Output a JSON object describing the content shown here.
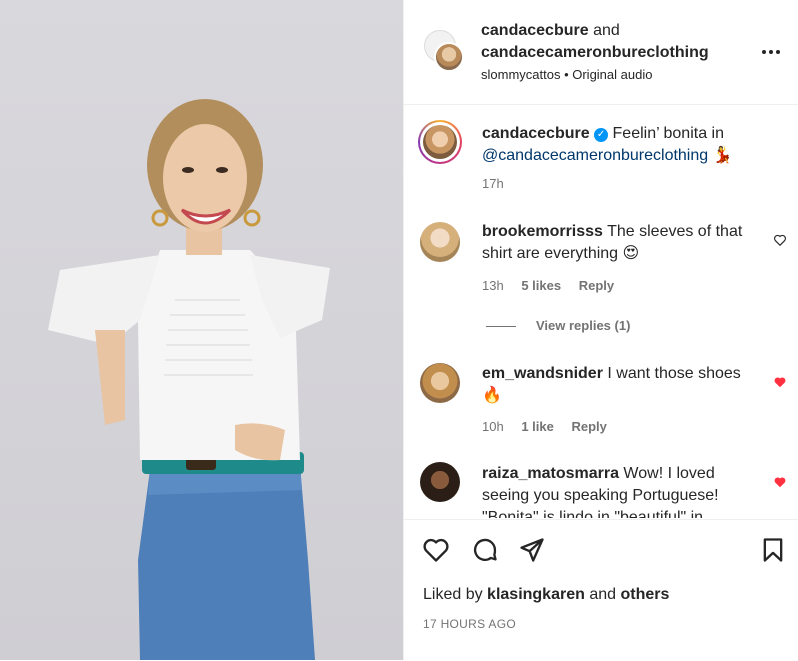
{
  "media": {
    "alt": "",
    "colors": {
      "backdrop": "#d6d5da",
      "shirt": "#f7f7f7",
      "skirt": "#4f7fb8",
      "belt": "#1f8a8a"
    }
  },
  "header": {
    "user1": "candacecbure",
    "and_text": "and",
    "user2": "candacecameronbureclothing",
    "subtitle": "slommycattos • Original audio",
    "more_icon": "more-horizontal-icon"
  },
  "caption": {
    "username": "candacecbure",
    "verified_icon": "verified-badge-icon",
    "text": "Feelin’ bonita in",
    "mention": "@candacecameronbureclothing",
    "emoji": "💃",
    "time": "17h"
  },
  "comments": [
    {
      "username": "brookemorrisss",
      "text": "The sleeves of that shirt are everything 😍",
      "time": "13h",
      "likes": "5 likes",
      "reply": "Reply",
      "liked": false
    },
    {
      "view_replies": "View replies (1)"
    },
    {
      "username": "em_wandsnider",
      "text": "I want those shoes 🔥",
      "time": "10h",
      "likes": "1 like",
      "reply": "Reply",
      "liked": true
    },
    {
      "username": "raiza_matosmarra",
      "text": "Wow! I loved seeing you speaking Portuguese! \"Bonita\" is lindo in \"beautiful\" in",
      "liked": true
    }
  ],
  "actions": {
    "like_icon": "heart-icon",
    "comment_icon": "comment-icon",
    "share_icon": "send-icon",
    "save_icon": "bookmark-icon",
    "liked_by_prefix": "Liked by",
    "liked_by_user": "klasingkaren",
    "liked_by_and": "and",
    "liked_by_others": "others",
    "time_ago": "17 HOURS AGO"
  },
  "accent": "#0095f6",
  "like_red": "#ff3040"
}
